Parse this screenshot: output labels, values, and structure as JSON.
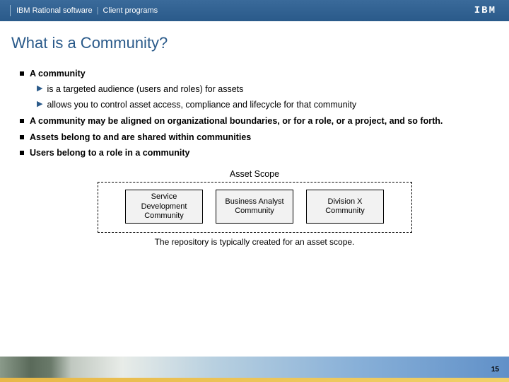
{
  "header": {
    "left1": "IBM Rational software",
    "left2": "Client programs",
    "logo": "IBM"
  },
  "title": "What is a Community?",
  "bullets": [
    {
      "text": "A community",
      "children": [
        {
          "text": "is a targeted audience (users and roles) for assets"
        },
        {
          "text": "allows you to control asset access, compliance and lifecycle for that community"
        }
      ]
    },
    {
      "text": "A community may be aligned on organizational boundaries, or for a role, or a project, and so forth.",
      "children": []
    },
    {
      "text": "Assets belong to and are shared within communities",
      "children": []
    },
    {
      "text": "Users belong to a role in a community",
      "children": []
    }
  ],
  "diagram": {
    "title": "Asset Scope",
    "cells": [
      "Service Development Community",
      "Business Analyst Community",
      "Division X Community"
    ],
    "caption": "The repository is typically created for an asset scope."
  },
  "page": "15"
}
